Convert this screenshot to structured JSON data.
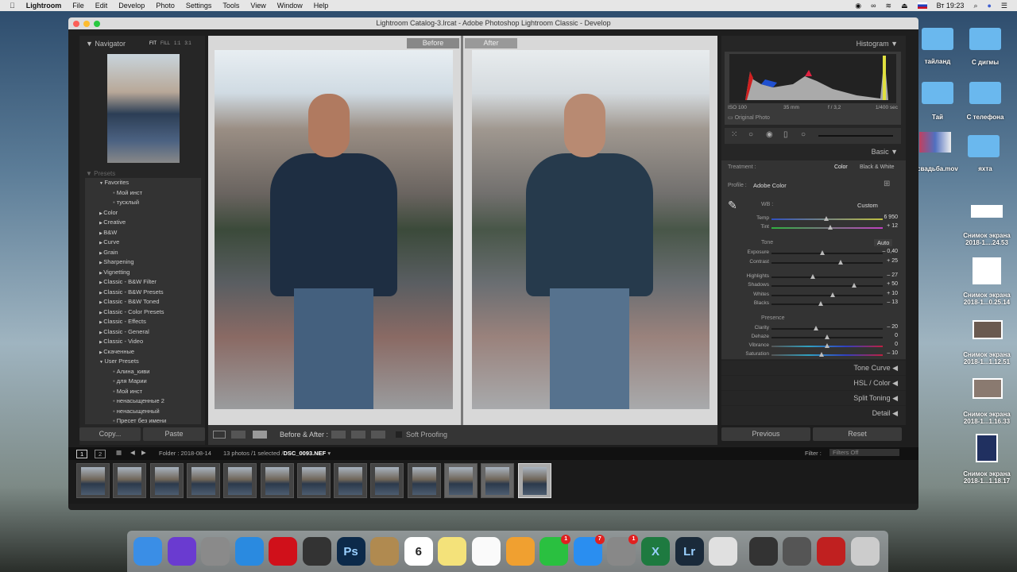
{
  "menubar": {
    "apple": "",
    "app": "Lightroom",
    "items": [
      "File",
      "Edit",
      "Develop",
      "Photo",
      "Settings",
      "Tools",
      "View",
      "Window",
      "Help"
    ],
    "clock": "Вт 19:23"
  },
  "window": {
    "title": "Lightroom Catalog-3.lrcat - Adobe Photoshop Lightroom Classic - Develop"
  },
  "navigator": {
    "title": "Navigator",
    "modes": [
      "FIT",
      "FILL",
      "1:1",
      "3:1"
    ]
  },
  "presets": {
    "title": "Presets",
    "items": [
      {
        "label": "Favorites",
        "type": "group",
        "open": true
      },
      {
        "label": "Мой инст",
        "type": "preset"
      },
      {
        "label": "тусклый",
        "type": "preset"
      },
      {
        "label": "Color",
        "type": "group"
      },
      {
        "label": "Creative",
        "type": "group"
      },
      {
        "label": "B&W",
        "type": "group"
      },
      {
        "label": "Curve",
        "type": "group"
      },
      {
        "label": "Grain",
        "type": "group"
      },
      {
        "label": "Sharpening",
        "type": "group"
      },
      {
        "label": "Vignetting",
        "type": "group"
      },
      {
        "label": "Classic - B&W Filter",
        "type": "group"
      },
      {
        "label": "Classic - B&W Presets",
        "type": "group"
      },
      {
        "label": "Classic - B&W Toned",
        "type": "group"
      },
      {
        "label": "Classic - Color Presets",
        "type": "group"
      },
      {
        "label": "Classic - Effects",
        "type": "group"
      },
      {
        "label": "Classic - General",
        "type": "group"
      },
      {
        "label": "Classic - Video",
        "type": "group"
      },
      {
        "label": "Скаченные",
        "type": "group"
      },
      {
        "label": "User Presets",
        "type": "group",
        "open": true
      },
      {
        "label": "Алина_киви",
        "type": "preset"
      },
      {
        "label": "для Марии",
        "type": "preset"
      },
      {
        "label": "Мой инст",
        "type": "preset"
      },
      {
        "label": "ненасыщенные 2",
        "type": "preset"
      },
      {
        "label": "ненасыщенный",
        "type": "preset"
      },
      {
        "label": "Пресет без имени",
        "type": "preset"
      }
    ],
    "copy": "Copy...",
    "paste": "Paste"
  },
  "view": {
    "before": "Before",
    "after": "After"
  },
  "toolbar": {
    "before_after": "Before & After :",
    "soft_proofing": "Soft Proofing"
  },
  "histogram": {
    "title": "Histogram",
    "iso": "ISO 100",
    "focal": "35 mm",
    "aperture": "f / 3,2",
    "shutter": "1/400 sec",
    "original_photo": "Original Photo"
  },
  "basic": {
    "title": "Basic",
    "treatment_label": "Treatment :",
    "color": "Color",
    "bw": "Black & White",
    "profile_label": "Profile :",
    "profile": "Adobe Color",
    "wb_label": "WB :",
    "wb": "Custom",
    "tone_label": "Tone",
    "auto": "Auto",
    "presence_label": "Presence",
    "sliders": [
      {
        "label": "Temp",
        "value": "6 950",
        "pos": 0.49,
        "kind": "temp"
      },
      {
        "label": "Tint",
        "value": "+ 12",
        "pos": 0.53,
        "kind": "tint"
      },
      {
        "label": "Exposure",
        "value": "– 0,40",
        "pos": 0.46
      },
      {
        "label": "Contrast",
        "value": "+ 25",
        "pos": 0.62
      },
      {
        "label": "Highlights",
        "value": "– 27",
        "pos": 0.37
      },
      {
        "label": "Shadows",
        "value": "+ 50",
        "pos": 0.74
      },
      {
        "label": "Whites",
        "value": "+ 10",
        "pos": 0.55
      },
      {
        "label": "Blacks",
        "value": "– 13",
        "pos": 0.44
      },
      {
        "label": "Clarity",
        "value": "– 20",
        "pos": 0.4
      },
      {
        "label": "Dehaze",
        "value": "0",
        "pos": 0.5
      },
      {
        "label": "Vibrance",
        "value": "0",
        "pos": 0.5,
        "kind": "vib"
      },
      {
        "label": "Saturation",
        "value": "– 10",
        "pos": 0.45,
        "kind": "vib"
      }
    ]
  },
  "sections": [
    "Tone Curve",
    "HSL / Color",
    "Split Toning",
    "Detail"
  ],
  "buttons": {
    "previous": "Previous",
    "reset": "Reset"
  },
  "filmstrip": {
    "page1": "1",
    "page2": "2",
    "folder": "Folder : 2018-08-14",
    "count": "13 photos /1 selected /",
    "file": "DSC_0093.NEF",
    "filter_label": "Filter :",
    "filter": "Filters Off",
    "thumb_count": 13
  },
  "desktop": [
    {
      "label": "тайланд",
      "type": "folder"
    },
    {
      "label": "С дигмы",
      "type": "folder"
    },
    {
      "label": "Тай",
      "type": "folder"
    },
    {
      "label": "С телефона",
      "type": "folder"
    },
    {
      "label": "свадьба.mov",
      "type": "video"
    },
    {
      "label": "яхта",
      "type": "folder"
    },
    {
      "label": "Снимок экрана 2018-1....24.53",
      "type": "image"
    },
    {
      "label": "Снимок экрана 2018-1...0.25.14",
      "type": "image"
    },
    {
      "label": "Снимок экрана 2018-1...1.12.51",
      "type": "image"
    },
    {
      "label": "Снимок экрана 2018-1...1.16.33",
      "type": "image"
    },
    {
      "label": "Снимок экрана 2018-1...1.18.17",
      "type": "image"
    }
  ],
  "dock": {
    "apps": [
      {
        "name": "finder",
        "color": "#3a8ee6"
      },
      {
        "name": "siri",
        "color": "#6a3bd0"
      },
      {
        "name": "launchpad",
        "color": "#8a8a8a"
      },
      {
        "name": "safari",
        "color": "#2a8ae0"
      },
      {
        "name": "opera",
        "color": "#d0101a"
      },
      {
        "name": "final-cut",
        "color": "#333"
      },
      {
        "name": "photoshop",
        "color": "#0c2a4a",
        "label": "Ps"
      },
      {
        "name": "archive",
        "color": "#b08a50"
      },
      {
        "name": "calendar",
        "color": "#fff",
        "label": "6"
      },
      {
        "name": "notes",
        "color": "#f4e27a"
      },
      {
        "name": "reminders",
        "color": "#fafafa"
      },
      {
        "name": "photos",
        "color": "#f0a030"
      },
      {
        "name": "facetime",
        "color": "#2ac040",
        "badge": "1"
      },
      {
        "name": "app-store",
        "color": "#2a8ef0",
        "badge": "7"
      },
      {
        "name": "system-preferences",
        "color": "#888",
        "badge": "1"
      },
      {
        "name": "excel",
        "color": "#1e7a40",
        "label": "X"
      },
      {
        "name": "lightroom",
        "color": "#1a2a3a",
        "label": "Lr"
      },
      {
        "name": "chrome",
        "color": "#e0e0e0"
      },
      {
        "name": "quicktime",
        "color": "#333"
      },
      {
        "name": "screenshot",
        "color": "#555"
      },
      {
        "name": "photo-booth",
        "color": "#c02020"
      },
      {
        "name": "trash",
        "color": "#ccc"
      }
    ]
  }
}
